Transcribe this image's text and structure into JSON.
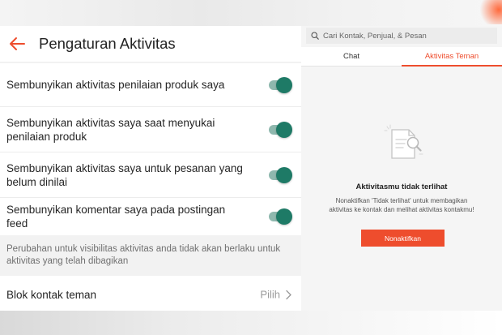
{
  "colors": {
    "accent": "#ee4d2d",
    "toggle_on": "#1e7a66",
    "toggle_track": "#8fb8ae"
  },
  "left_panel": {
    "header": {
      "back_icon": "arrow-left-icon",
      "title": "Pengaturan Aktivitas"
    },
    "settings": [
      {
        "label": "Sembunyikan aktivitas penilaian produk saya",
        "enabled": true
      },
      {
        "label": "Sembunyikan aktivitas saya saat menyukai penilaian produk",
        "enabled": true
      },
      {
        "label": "Sembunyikan aktivitas saya untuk pesanan yang belum dinilai",
        "enabled": true
      },
      {
        "label": "Sembunyikan komentar saya pada postingan feed",
        "enabled": true
      }
    ],
    "note": "Perubahan untuk visibilitas aktivitas anda tidak akan berlaku untuk aktivitas yang telah dibagikan",
    "block_contacts": {
      "label": "Blok kontak teman",
      "value": "Pilih",
      "icon": "chevron-right-icon"
    }
  },
  "right_panel": {
    "search": {
      "icon": "search-icon",
      "placeholder": "Cari Kontak, Penjual, & Pesan"
    },
    "tabs": [
      {
        "label": "Chat",
        "active": false
      },
      {
        "label": "Aktivitas Teman",
        "active": true
      }
    ],
    "empty_state": {
      "icon": "document-search-icon",
      "title": "Aktivitasmu tidak terlihat",
      "description": "Nonaktifkan 'Tidak terlihat' untuk membagikan aktivitas ke kontak dan melihat aktivitas kontakmu!",
      "button_label": "Nonaktifkan"
    }
  }
}
